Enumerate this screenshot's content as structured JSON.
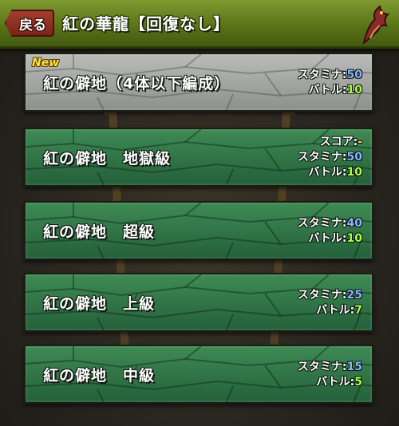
{
  "header": {
    "back_label": "戻る",
    "title": "紅の華龍【回復なし】"
  },
  "dungeons": [
    {
      "new_label": "New",
      "name": "紅の僻地（4体以下編成）",
      "stamina_label": "スタミナ:",
      "stamina": "50",
      "battle_label": "バトル:",
      "battle": "10",
      "style": "gray"
    },
    {
      "name": "紅の僻地　地獄級",
      "score_label": "スコア:",
      "score": "-",
      "stamina_label": "スタミナ:",
      "stamina": "50",
      "battle_label": "バトル:",
      "battle": "10",
      "style": "green"
    },
    {
      "name": "紅の僻地　超級",
      "stamina_label": "スタミナ:",
      "stamina": "40",
      "battle_label": "バトル:",
      "battle": "10",
      "style": "green"
    },
    {
      "name": "紅の僻地　上級",
      "stamina_label": "スタミナ:",
      "stamina": "25",
      "battle_label": "バトル:",
      "battle": "7",
      "style": "green"
    },
    {
      "name": "紅の僻地　中級",
      "stamina_label": "スタミナ:",
      "stamina": "15",
      "battle_label": "バトル:",
      "battle": "5",
      "style": "green"
    }
  ]
}
